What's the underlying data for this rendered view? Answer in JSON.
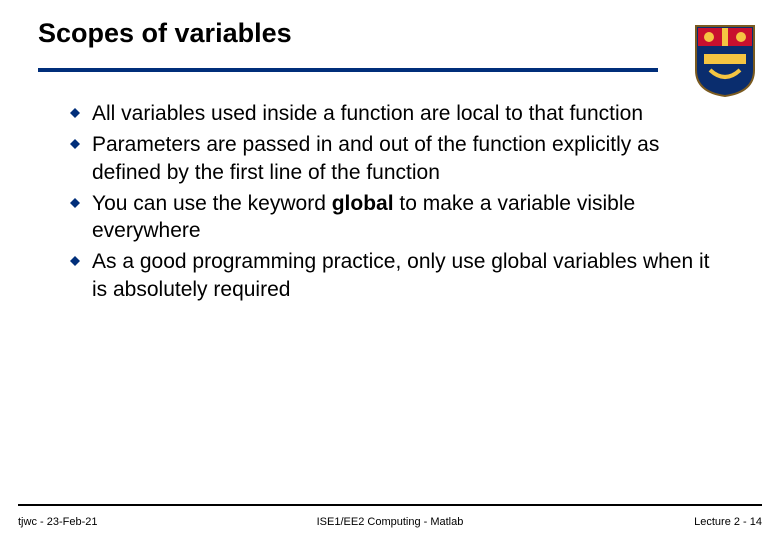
{
  "title": "Scopes of variables",
  "bullets": [
    {
      "pre": "All variables used inside a function are local to that function",
      "kw": "",
      "post": ""
    },
    {
      "pre": "Parameters are passed in and out of the function explicitly as defined by the first line of the function",
      "kw": "",
      "post": ""
    },
    {
      "pre": "You can use the keyword ",
      "kw": "global",
      "post": "  to make a variable visible everywhere"
    },
    {
      "pre": "As a good programming practice, only use global variables when it is absolutely required",
      "kw": "",
      "post": ""
    }
  ],
  "footer": {
    "left": "tjwc - 23-Feb-21",
    "center": "ISE1/EE2 Computing - Matlab",
    "right": "Lecture 2 - 14"
  },
  "colors": {
    "accent": "#002e7a"
  }
}
